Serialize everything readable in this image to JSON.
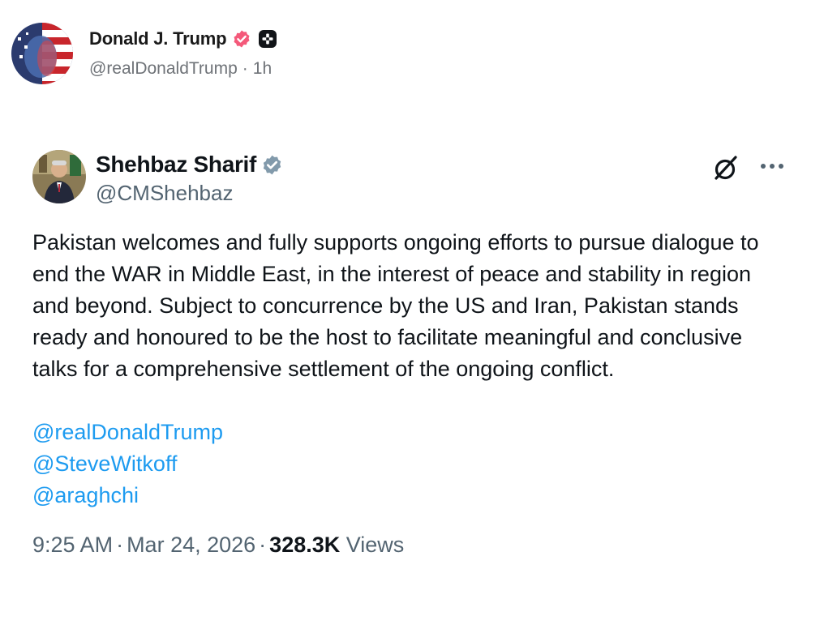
{
  "post": {
    "author_name": "Donald J. Trump",
    "author_handle": "@realDonaldTrump",
    "separator": "·",
    "age": "1h"
  },
  "tweet": {
    "author_name": "Shehbaz Sharif",
    "author_handle": "@CMShehbaz",
    "text": "Pakistan welcomes and fully supports ongoing efforts to pursue dialogue to end the WAR in Middle East, in the interest of peace and stability in region and beyond. Subject to concurrence by the US and Iran, Pakistan stands ready and honoured to be the host to facilitate meaningful and conclusive talks for a comprehensive settlement of the ongoing conflict.",
    "mentions": [
      "@realDonaldTrump",
      "@SteveWitkoff",
      "@araghchi"
    ],
    "time": "9:25 AM",
    "date": "Mar 24, 2026",
    "separator": "·",
    "views_count": "328.3K",
    "views_label": "Views"
  },
  "icons": {
    "outer_verified": "verified-badge-icon",
    "outer_badge": "plus-badge-icon",
    "tweet_verified": "verified-badge-icon",
    "grok": "grok-icon",
    "more": "more-options-icon"
  },
  "colors": {
    "outer_verified": "#f4597a",
    "tweet_verified": "#829aab",
    "mention": "#1d9bf0",
    "secondary_text": "#536471"
  }
}
